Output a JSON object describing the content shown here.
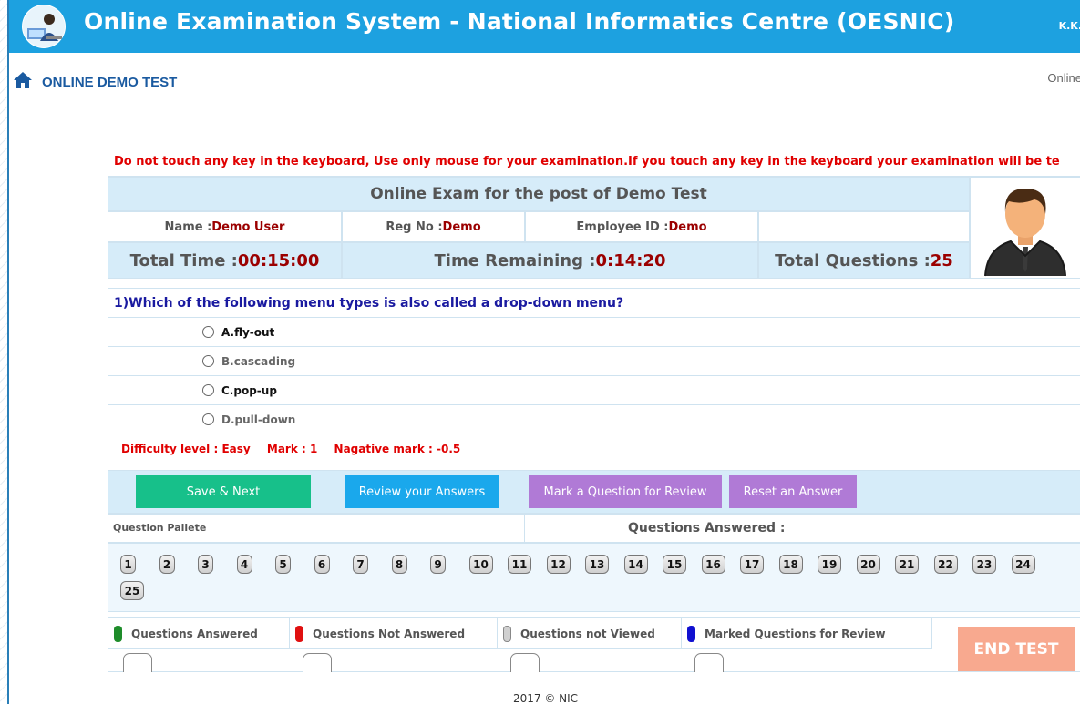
{
  "header": {
    "title": "Online Examination System - National Informatics Centre (OESNIC)",
    "user_short": "K.K."
  },
  "subheader": {
    "breadcrumb": "ONLINE DEMO TEST",
    "right_text": "Online"
  },
  "warning": "Do not touch any key in the keyboard, Use only mouse for your examination.If you touch any key in the keyboard your examination will be te",
  "exam": {
    "title": "Online Exam for the post of Demo Test",
    "name_label": "Name : ",
    "name_value": "Demo User",
    "reg_label": "Reg No :",
    "reg_value": "Demo",
    "emp_label": "Employee ID :",
    "emp_value": "Demo",
    "total_time_label": "Total Time : ",
    "total_time_value": "00:15:00",
    "remaining_label": "Time Remaining  : ",
    "remaining_value": "0:14:20",
    "total_questions_label": "Total Questions : ",
    "total_questions_value": "25"
  },
  "question": {
    "text": "1)Which of the following menu types is also called a drop-down menu?",
    "options": [
      "A.fly-out",
      "B.cascading",
      "C.pop-up",
      "D.pull-down"
    ],
    "difficulty": "Difficulty level : Easy",
    "mark": "Mark : 1",
    "negative": "Nagative mark : -0.5"
  },
  "buttons": {
    "save_next": "Save & Next",
    "review": "Review your Answers",
    "mark_review": "Mark a Question for Review",
    "reset": "Reset an Answer",
    "end_test": "END TEST"
  },
  "palette": {
    "title": "Question Pallete",
    "answered_title": "Questions Answered :",
    "numbers": [
      "1",
      "2",
      "3",
      "4",
      "5",
      "6",
      "7",
      "8",
      "9",
      "10",
      "11",
      "12",
      "13",
      "14",
      "15",
      "16",
      "17",
      "18",
      "19",
      "20",
      "21",
      "22",
      "23",
      "24",
      "25"
    ]
  },
  "legend": {
    "items": [
      {
        "label": "Questions Answered",
        "color": "#1e8c2a"
      },
      {
        "label": "Questions Not Answered",
        "color": "#e01010"
      },
      {
        "label": "Questions not Viewed",
        "color": "#d0d0d0"
      },
      {
        "label": "Marked Questions for Review",
        "color": "#1010d0"
      }
    ]
  },
  "colors": {
    "topbar": "#1da1e0",
    "save_btn": "#17c08a",
    "review_btn": "#1aa8ec",
    "mark_btn": "#b07ad6",
    "end_btn": "#f8a98f"
  },
  "footer": "2017 © NIC"
}
